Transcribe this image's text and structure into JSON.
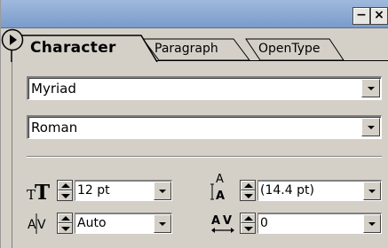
{
  "palette": {
    "window_controls": {
      "minimize": "−",
      "close": "×"
    },
    "tabs": [
      {
        "label": "Character",
        "active": true
      },
      {
        "label": "Paragraph",
        "active": false
      },
      {
        "label": "OpenType",
        "active": false
      }
    ],
    "font_family": {
      "value": "Myriad"
    },
    "font_style": {
      "value": "Roman"
    },
    "font_size": {
      "value": "12 pt",
      "icon": "font-size-icon"
    },
    "leading": {
      "value": "(14.4 pt)",
      "icon": "leading-icon"
    },
    "kerning": {
      "value": "Auto",
      "icon": "kerning-icon"
    },
    "tracking": {
      "value": "0",
      "icon": "tracking-icon"
    }
  },
  "colors": {
    "title_bar": "#8aa8d4",
    "panel_bg": "#d4d0c8",
    "field_bg": "#ffffff"
  }
}
